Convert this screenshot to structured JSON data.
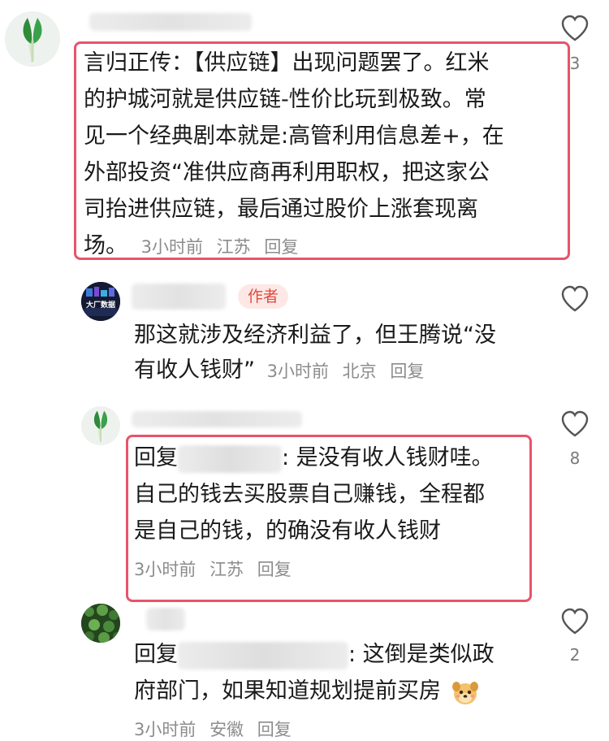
{
  "comments": [
    {
      "lines": [
        "言归正传：【供应链】出现问题罢了。红米",
        "的护城河就是供应链-性价比玩到极致。常",
        "见一个经典剧本就是:高管利用信息差+，在",
        "外部投资“准供应商再利用职权，把这家公",
        "司抬进供应链，最后通过股价上涨套现离"
      ],
      "last_line": "场。",
      "time": "3小时前",
      "location": "江苏",
      "reply_label": "回复",
      "like_count": "3"
    },
    {
      "author_badge": "作者",
      "avatar_text": "大厂数据",
      "lines": [
        "那这就涉及经济利益了，但王腾说“没"
      ],
      "last_line": "有收人钱财”",
      "time": "3小时前",
      "location": "北京",
      "reply_label": "回复"
    },
    {
      "reply_prefix": "回复",
      "line1_suffix": ": 是没有收人钱财哇。",
      "lines": [
        "自己的钱去买股票自己赚钱，全程都",
        "是自己的钱，的确没有收人钱财"
      ],
      "time": "3小时前",
      "location": "江苏",
      "reply_label": "回复",
      "like_count": "8"
    },
    {
      "reply_prefix": "回复",
      "line1_suffix": ": 这倒是类似政",
      "lines": [
        "府部门，如果知道规划提前买房"
      ],
      "time": "3小时前",
      "location": "安徽",
      "reply_label": "回复",
      "like_count": "2"
    }
  ],
  "colors": {
    "highlight_border": "#e8536b",
    "author_badge_bg": "#fde8e6",
    "author_badge_text": "#e24a3c",
    "meta_text": "#8c8c8c"
  },
  "icons": [
    "heart-outline-icon",
    "bok-choy-avatar",
    "author-avatar",
    "green-leaves-avatar",
    "dog-face-emoji"
  ]
}
